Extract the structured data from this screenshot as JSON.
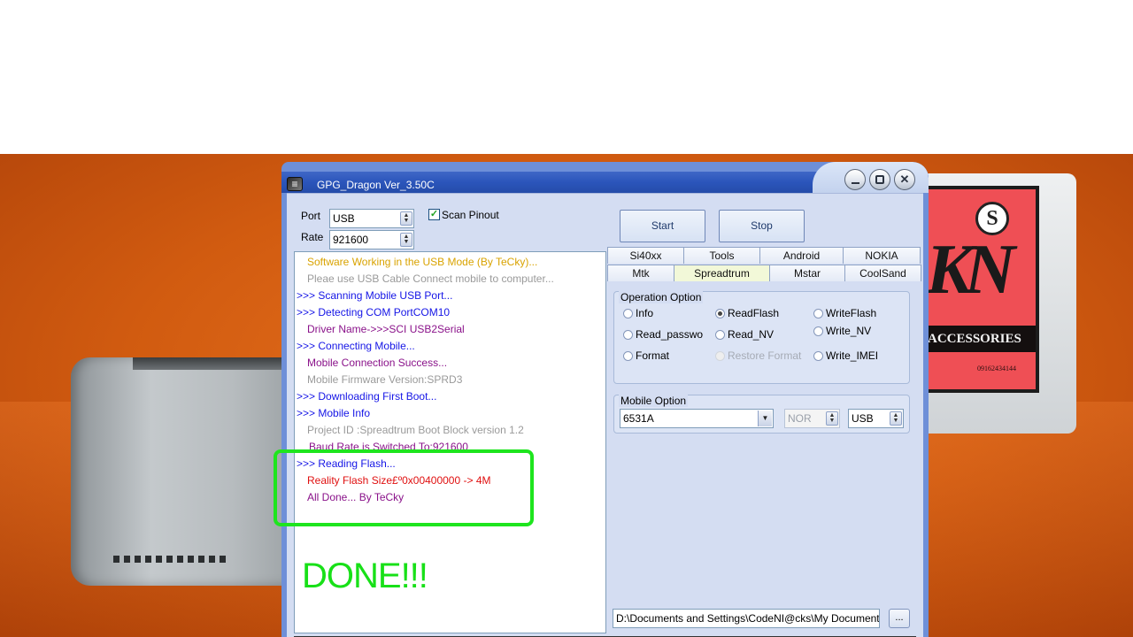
{
  "window": {
    "title": "GPG_Dragon  Ver_3.50C",
    "minimize_glyph": "",
    "maximize_glyph": "",
    "close_glyph": "✕"
  },
  "connection": {
    "port_label": "Port",
    "port_value": "USB",
    "rate_label": "Rate",
    "rate_value": "921600",
    "scan_pinout_label": "Scan Pinout",
    "scan_pinout_checked": true
  },
  "buttons": {
    "start": "Start",
    "stop": "Stop",
    "browse": "..."
  },
  "tabs_row1": [
    "Si40xx",
    "Tools",
    "Android",
    "NOKIA"
  ],
  "tabs_row2": [
    "Mtk",
    "Spreadtrum",
    "Mstar",
    "CoolSand"
  ],
  "active_tab": "Spreadtrum",
  "operation_option": {
    "title": "Operation Option",
    "options": [
      {
        "label": "Info",
        "checked": false,
        "disabled": false
      },
      {
        "label": "ReadFlash",
        "checked": true,
        "disabled": false
      },
      {
        "label": "WriteFlash",
        "checked": false,
        "disabled": false
      },
      {
        "label": "Read_passwo",
        "checked": false,
        "disabled": false
      },
      {
        "label": "Read_NV",
        "checked": false,
        "disabled": false
      },
      {
        "label": "Write_NV",
        "checked": false,
        "disabled": false
      },
      {
        "label": "Format",
        "checked": false,
        "disabled": false
      },
      {
        "label": "Restore Format",
        "checked": false,
        "disabled": true
      },
      {
        "label": "Write_IMEI",
        "checked": false,
        "disabled": false
      }
    ]
  },
  "mobile_option": {
    "title": "Mobile Option",
    "chip": "6531A",
    "memory": "NOR",
    "interface": "USB"
  },
  "path": "D:\\Documents and Settings\\CodeNI@cks\\My Documents",
  "log": [
    {
      "text": "Software Working in the USB Mode (By TeCky)...",
      "color": "#d9a300"
    },
    {
      "text": "Pleae use USB Cable Connect mobile to computer...",
      "color": "#9a9a9a"
    },
    {
      "text": ">>> Scanning Mobile USB Port...",
      "color": "#1515e6"
    },
    {
      "text": ">>> Detecting COM PortCOM10",
      "color": "#1515e6"
    },
    {
      "text": "Driver Name->>>SCI USB2Serial",
      "color": "#8a128a"
    },
    {
      "text": ">>> Connecting Mobile...",
      "color": "#1515e6"
    },
    {
      "text": "Mobile Connection Success...",
      "color": "#8a128a"
    },
    {
      "text": "Mobile Firmware Version:SPRD3",
      "color": "#9a9a9a"
    },
    {
      "text": ">>> Downloading First Boot...",
      "color": "#1515e6"
    },
    {
      "text": ">>> Mobile Info",
      "color": "#1515e6"
    },
    {
      "text": "Project ID :Spreadtrum Boot Block version 1.2",
      "color": "#9a9a9a"
    },
    {
      "text": "Baud Rate is Switched To:921600",
      "color": "#8a128a"
    },
    {
      "text": ">>> Reading Flash...",
      "color": "#1515e6"
    },
    {
      "text": "Reality Flash Size£º0x00400000  -> 4M",
      "color": "#e01010"
    },
    {
      "text": "All Done... By TeCky",
      "color": "#8a128a"
    }
  ],
  "done_text": "DONE!!!",
  "background": {
    "banner_text": "ACCESSORIES",
    "phone_text": "09162434144",
    "logo_letter": "S"
  },
  "colors": {
    "highlight": "#1ee51e",
    "title_bar": "#2b55bb"
  }
}
